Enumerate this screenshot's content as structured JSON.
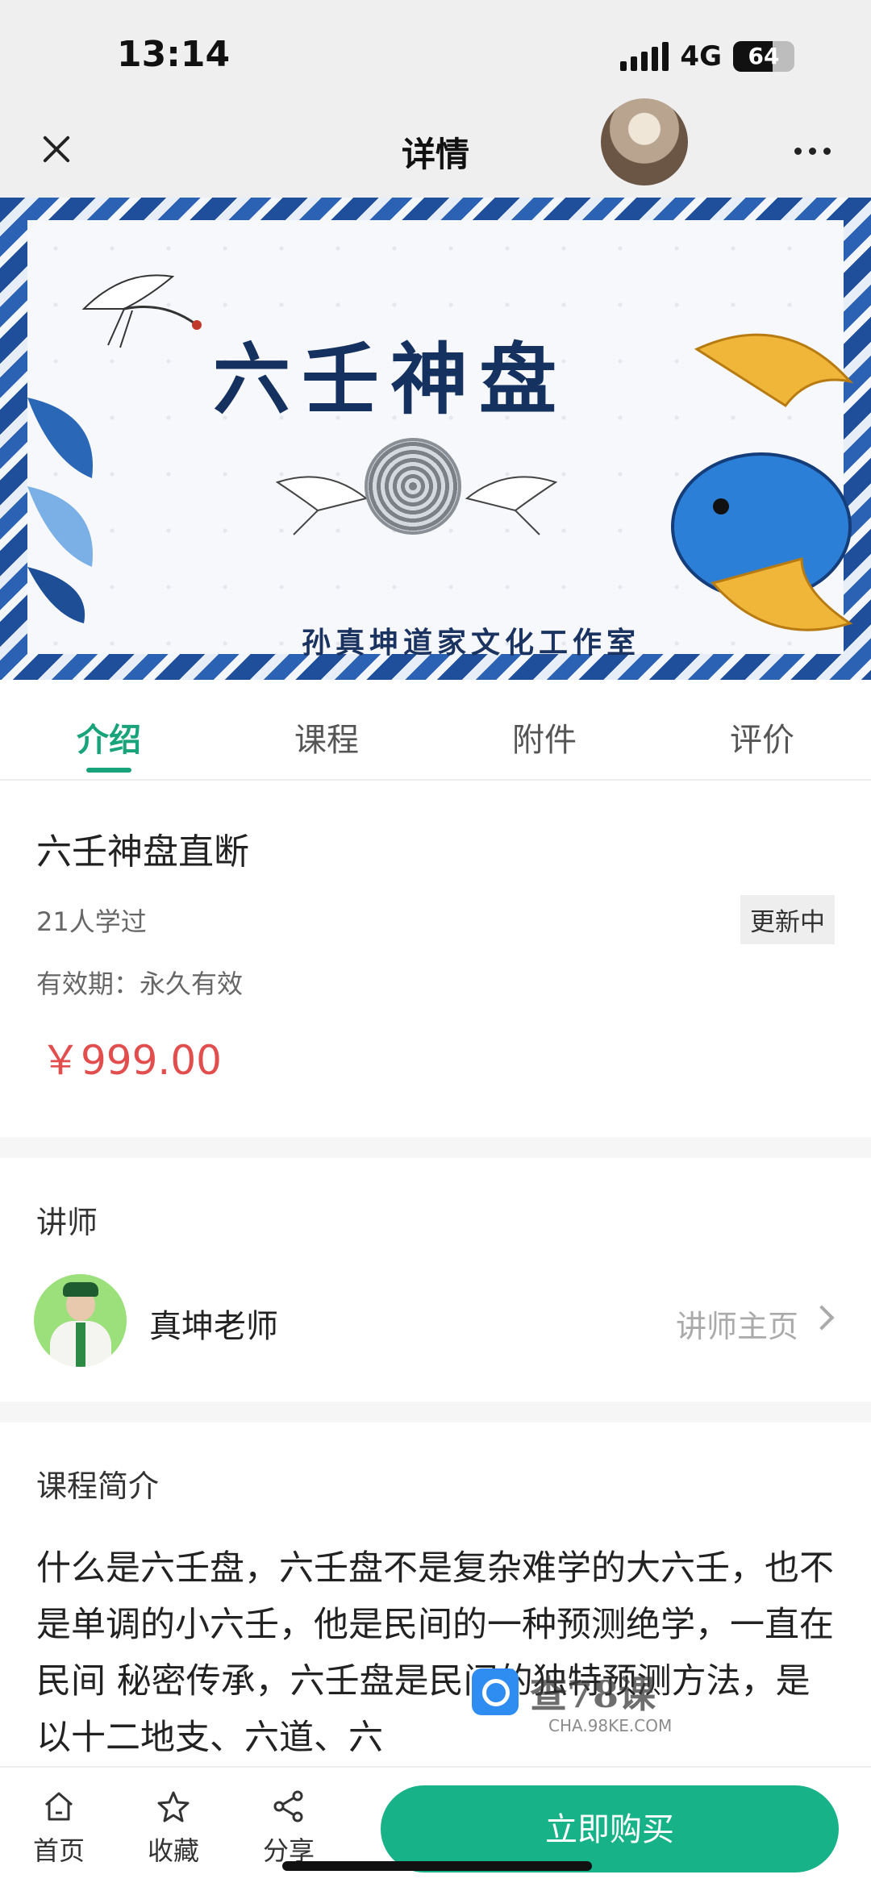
{
  "status_bar": {
    "time": "13:14",
    "network": "4G",
    "battery": "64",
    "battery_level": 0.64
  },
  "nav": {
    "title": "详情"
  },
  "banner": {
    "title": "六壬神盘",
    "subtitle": "孙真坤道家文化工作室"
  },
  "tabs": [
    {
      "label": "介绍",
      "active": true
    },
    {
      "label": "课程",
      "active": false
    },
    {
      "label": "附件",
      "active": false
    },
    {
      "label": "评价",
      "active": false
    }
  ],
  "course": {
    "title": "六壬神盘直断",
    "learners": "21人学过",
    "status": "更新中",
    "validity": "有效期：永久有效",
    "price": "￥999.00"
  },
  "teacher": {
    "section_title": "讲师",
    "name": "真坤老师",
    "link": "讲师主页"
  },
  "intro": {
    "section_title": "课程简介",
    "text": "什么是六壬盘，六壬盘不是复杂难学的大六壬，也不 是单调的小六壬，他是民间的一种预测绝学，一直在民间 秘密传承，六壬盘是民间的独特预测方法，是以十二地支、六道、六"
  },
  "watermark": {
    "text": "查78课",
    "url": "CHA.98KE.COM"
  },
  "bottom_bar": {
    "home": "首页",
    "favorite": "收藏",
    "share": "分享",
    "buy": "立即购买"
  },
  "colors": {
    "accent": "#19a37a",
    "buy": "#17b287",
    "price": "#e24d4d",
    "banner_blue": "#1f4f9a"
  },
  "icons": [
    "close-icon",
    "more-icon",
    "home-icon",
    "star-icon",
    "share-icon",
    "chevron-right-icon"
  ]
}
